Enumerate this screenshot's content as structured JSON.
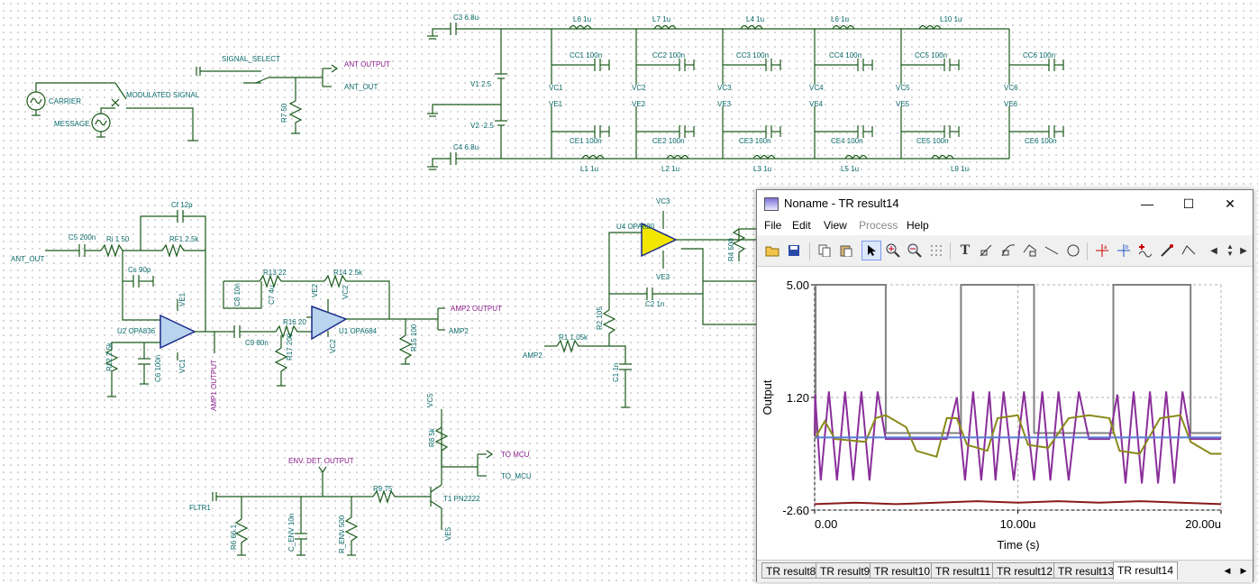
{
  "schematic": {
    "labels": {
      "c3": "C3 6.8u",
      "c4": "C4 6.8u",
      "l6a": "L6 1u",
      "l7": "L7 1u",
      "l4": "L4 1u",
      "l6b": "L6 1u",
      "l10": "L10 1u",
      "l1": "L1 1u",
      "l2": "L2 1u",
      "l3": "L3 1u",
      "l5": "L5 1u",
      "l9": "L9 1u",
      "cc1": "CC1 100n",
      "cc2": "CC2 100n",
      "cc3": "CC3 100n",
      "cc4": "CC4 100n",
      "cc5": "CC5 100n",
      "cc6": "CC6 100n",
      "ce1": "CE1 100n",
      "ce2": "CE2 100n",
      "ce3": "CE3 100n",
      "ce4": "CE4 100n",
      "ce5": "CE5 100n",
      "ce6": "CE6 100n",
      "vc1": "VC1",
      "vc2": "VC2",
      "vc3": "VC3",
      "vc4": "VC4",
      "vc5": "VC5",
      "vc6": "VC6",
      "ve1": "VE1",
      "ve2": "VE2",
      "ve3": "VE3",
      "ve4": "VE4",
      "ve5": "VE5",
      "ve6": "VE6",
      "v1": "V1 2.5",
      "v2": "V2 -2.5",
      "signal_select": "SIGNAL_SELECT",
      "carrier": "CARRIER",
      "message": "MESSAGE",
      "modulated": "MODULATED SIGNAL",
      "ant_output": "ANT OUTPUT",
      "ant_out": "ANT_OUT",
      "r7": "R7 50",
      "ant_out_in": "ANT_OUT",
      "c5": "C5 200n",
      "ri": "Ri 1 50",
      "cf": "Cf 12p",
      "rf1": "RF1 2.5k",
      "cs": "Cs 90p",
      "u2": "U2 OPA836",
      "ve1b": "VE1",
      "vc1b": "VC1",
      "r12": "R12 2.5k",
      "c6": "C6 100n",
      "amp1": "AMP1 OUTPUT",
      "c9": "C9 80n",
      "r13": "R13 22",
      "r14": "R14 2.5k",
      "c8": "C8 10n",
      "c7": "C7 4u",
      "r16": "R16 20",
      "r17": "R17 200",
      "vc2b": "VC2",
      "vc2c": "VC2",
      "u1": "U1 OPA684",
      "amp2_output": "AMP2 OUTPUT",
      "amp2": "AMP2",
      "r15": "R15 100",
      "u4": "U4 OPA820",
      "r4": "R4 500",
      "c2": "C2 1n",
      "r2": "R2 105",
      "r1": "R1 1.05k",
      "amp2_in": "AMP2",
      "c1": "C1 1n",
      "r8": "R8 5k",
      "to_mcu_out": "TO MCU",
      "to_mcu": "TO_MCU",
      "env_det": "ENV. DET. OUTPUT",
      "fltr1": "FLTR1",
      "r9": "R9 75",
      "t1": "T1 PN2222",
      "r6": "R6 66.1",
      "c_env": "C_ENV 10n",
      "r_env": "R_ENV 500"
    }
  },
  "window": {
    "title": "Noname - TR result14",
    "controls": {
      "minimize": "—",
      "maximize": "☐",
      "close": "✕"
    },
    "menu": [
      "File",
      "Edit",
      "View",
      "Process",
      "Help"
    ],
    "menu_disabled": "Process",
    "toolbar_icons": [
      "open-icon",
      "save-icon",
      "copy-icon",
      "paste-icon",
      "pointer-icon",
      "zoom-in-icon",
      "zoom-out-icon",
      "grid-icon",
      "text-icon",
      "line-label-icon",
      "curve-label-icon",
      "curve-edit-icon",
      "line-icon",
      "circle-icon",
      "cursor-a-icon",
      "cursor-b-icon",
      "add-curve-icon",
      "probe-icon",
      "wave-icon",
      "left-icon",
      "up-down-icon",
      "right-icon"
    ],
    "tabs": [
      "TR result8",
      "TR result9",
      "TR result10",
      "TR result11",
      "TR result12",
      "TR result13",
      "TR result14"
    ],
    "active_tab": "TR result14"
  },
  "chart_data": {
    "type": "line",
    "xlabel": "Time (s)",
    "ylabel": "Output",
    "xlim": [
      0,
      20
    ],
    "ylim": [
      -2.6,
      5.0
    ],
    "x_ticks": [
      "0.00",
      "10.00u",
      "20.00u"
    ],
    "y_ticks": [
      "5.00",
      "1.20",
      "-2.60"
    ],
    "grid": "dashed",
    "series": [
      {
        "color": "#808080",
        "x": [
          0,
          0.05,
          0.05,
          3.5,
          3.5,
          7.2,
          7.2,
          10.8,
          10.8,
          14.7,
          14.7,
          18.5,
          18.5,
          20
        ],
        "y": [
          0,
          0,
          5,
          5,
          0,
          0,
          5,
          5,
          0,
          0,
          5,
          5,
          0,
          0
        ]
      },
      {
        "color": "#8a2f9a",
        "x": [
          0,
          0.02,
          0.3,
          0.7,
          1.1,
          1.5,
          1.9,
          2.3,
          2.7,
          3.1,
          3.5,
          4.5,
          6.5,
          7.0,
          7.4,
          7.8,
          8.2,
          8.6,
          8.9,
          9.3,
          9.8,
          10.3,
          10.8,
          11.2,
          11.6,
          12.0,
          12.5,
          13.0,
          13.5,
          14.5,
          14.9,
          15.3,
          15.7,
          16.1,
          16.5,
          16.9,
          17.3,
          17.7,
          18.1,
          18.5,
          19.5,
          20
        ],
        "y": [
          -0.1,
          1.3,
          -1.6,
          1.4,
          -1.6,
          1.4,
          -1.6,
          1.4,
          -1.6,
          1.4,
          -0.2,
          -0.2,
          -0.2,
          1.2,
          -1.6,
          1.4,
          -1.6,
          1.4,
          -1.6,
          1.4,
          -1.6,
          1.4,
          -1.6,
          1.4,
          -1.6,
          1.4,
          -1.6,
          1.4,
          -0.2,
          -0.2,
          1.3,
          -1.7,
          1.4,
          -1.7,
          1.4,
          -1.7,
          1.4,
          -1.7,
          1.4,
          -0.2,
          -0.2,
          -0.2
        ]
      },
      {
        "color": "#8a8a1a",
        "x": [
          0,
          0.5,
          1.0,
          2.5,
          3.0,
          3.5,
          4.5,
          5.0,
          6.0,
          6.5,
          7.0,
          7.5,
          8.5,
          9.0,
          10.0,
          10.5,
          11.5,
          12.5,
          13.5,
          14.5,
          15.0,
          16.0,
          17.0,
          18.0,
          18.5,
          19.5,
          20
        ],
        "y": [
          -0.2,
          0.4,
          -0.2,
          -0.3,
          0.5,
          0.6,
          0.2,
          -0.6,
          -0.8,
          0.5,
          0.5,
          -0.4,
          -0.6,
          0.5,
          0.6,
          -0.4,
          -0.5,
          0.5,
          0.6,
          0.5,
          -0.6,
          -0.7,
          0.5,
          0.6,
          -0.3,
          -0.7,
          -0.7
        ]
      },
      {
        "color": "#8a1a1a",
        "x": [
          0,
          2,
          4,
          6,
          8,
          10,
          12,
          14,
          16,
          18,
          20
        ],
        "y": [
          -2.4,
          -2.35,
          -2.4,
          -2.35,
          -2.3,
          -2.35,
          -2.3,
          -2.35,
          -2.3,
          -2.35,
          -2.4
        ]
      },
      {
        "color": "#5a7ad8",
        "x": [
          0,
          20
        ],
        "y": [
          -0.15,
          -0.15
        ]
      }
    ]
  }
}
